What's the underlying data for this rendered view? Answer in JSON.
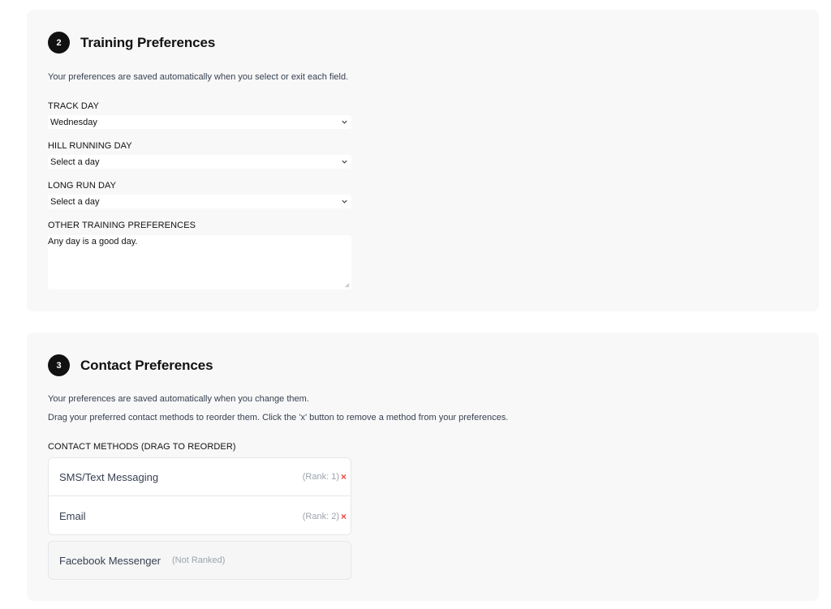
{
  "training": {
    "step": "2",
    "title": "Training Preferences",
    "note": "Your preferences are saved automatically when you select or exit each field.",
    "track_day": {
      "label": "TRACK DAY",
      "value": "Wednesday"
    },
    "hill_day": {
      "label": "HILL RUNNING DAY",
      "value": "Select a day"
    },
    "long_run_day": {
      "label": "LONG RUN DAY",
      "value": "Select a day"
    },
    "other": {
      "label": "OTHER TRAINING PREFERENCES",
      "value": "Any day is a good day."
    }
  },
  "contact": {
    "step": "3",
    "title": "Contact Preferences",
    "note1": "Your preferences are saved automatically when you change them.",
    "note2": "Drag your preferred contact methods to reorder them. Click the 'x' button to remove a method from your preferences.",
    "methods_label": "CONTACT METHODS (DRAG TO REORDER)",
    "ranked": [
      {
        "name": "SMS/Text Messaging",
        "rank": "(Rank: 1)",
        "remove": "×"
      },
      {
        "name": "Email",
        "rank": "(Rank: 2)",
        "remove": "×"
      }
    ],
    "unranked": [
      {
        "name": "Facebook Messenger",
        "status": "(Not Ranked)"
      }
    ]
  },
  "icons": {
    "select_arrow": "chevron-down-icon",
    "remove": "close-icon",
    "resize": "resize-handle-icon"
  },
  "colors": {
    "section_bg": "#f8f8f8",
    "step_badge": "#111111",
    "remove": "#ef4444",
    "muted_text": "#9ca3af"
  }
}
